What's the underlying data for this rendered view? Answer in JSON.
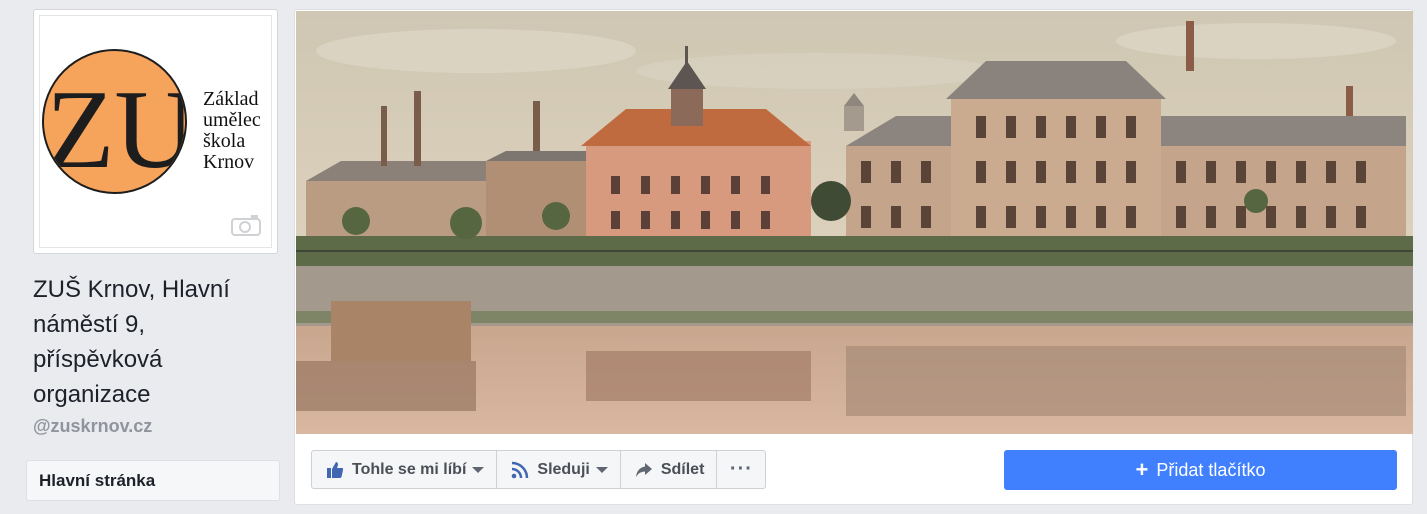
{
  "profile": {
    "logo_letters": "ZUŠ",
    "logo_text_lines": [
      "Základ",
      "umělec",
      "škola",
      "Krnov"
    ],
    "camera_icon": "camera-icon"
  },
  "page": {
    "name": "ZUŠ Krnov, Hlavní náměstí 9, příspěvková organizace",
    "handle": "@zuskrnov.cz"
  },
  "nav": {
    "main_page": "Hlavní stránka"
  },
  "actions": {
    "like": {
      "label": "Tohle se mi líbí",
      "icon": "thumbs-up-icon"
    },
    "follow": {
      "label": "Sleduji",
      "icon": "rss-icon"
    },
    "share": {
      "label": "Sdílet",
      "icon": "share-arrow-icon"
    },
    "more": {
      "label": "···",
      "icon": "more-icon"
    }
  },
  "cta": {
    "label": "Přidat tlačítko",
    "icon": "plus-icon"
  },
  "colors": {
    "accent": "#4080ff",
    "logo_orange": "#f6a35c",
    "background": "#e9ebee"
  }
}
